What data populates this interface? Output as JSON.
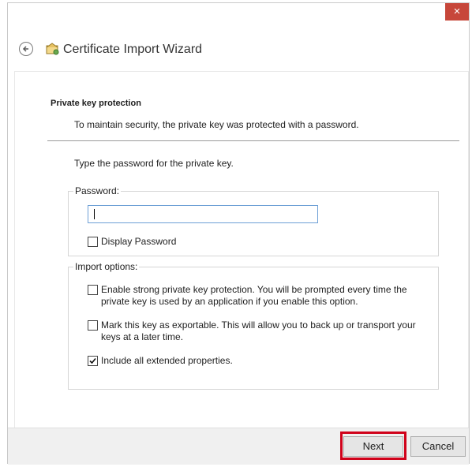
{
  "window": {
    "title": "Certificate Import Wizard",
    "close_label": "×"
  },
  "section": {
    "heading": "Private key protection",
    "description": "To maintain security, the private key was protected with a password."
  },
  "prompt": "Type the password for the private key.",
  "password_group": {
    "label": "Password:",
    "input_value": "",
    "display_password_label": "Display Password",
    "display_password_checked": false
  },
  "import_options": {
    "label": "Import options:",
    "options": [
      {
        "line1": "Enable strong private key protection. You will be prompted every time the",
        "line2": "private key is used by an application if you enable this option.",
        "checked": false
      },
      {
        "line1": "Mark this key as exportable. This will allow you to back up or transport your",
        "line2": "keys at a later time.",
        "checked": false
      },
      {
        "line1": "Include all extended properties.",
        "line2": "",
        "checked": true
      }
    ]
  },
  "footer": {
    "next_label": "Next",
    "cancel_label": "Cancel"
  },
  "colors": {
    "highlight": "#d0021b",
    "close_bg": "#c7473a",
    "input_border": "#6ea0d6"
  },
  "icons": {
    "back": "back-arrow-icon",
    "wizard": "certificate-icon",
    "close": "close-icon"
  }
}
